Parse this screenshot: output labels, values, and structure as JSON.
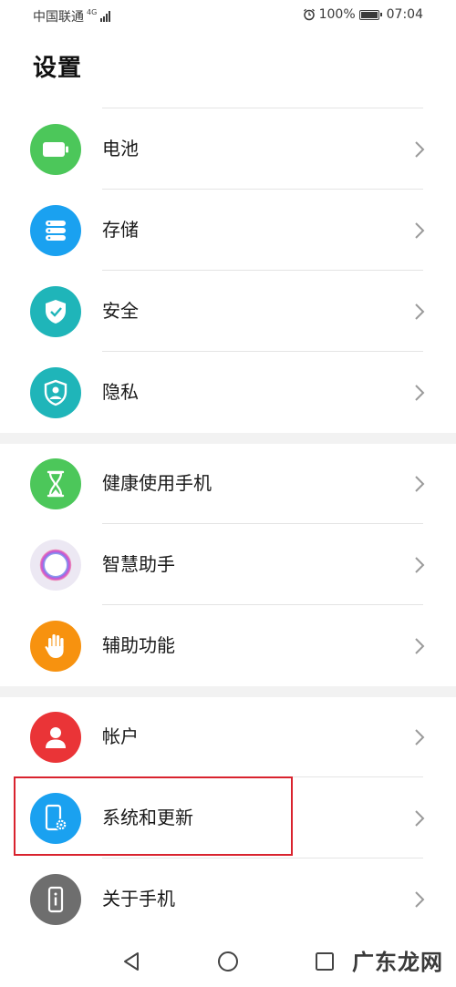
{
  "status_bar": {
    "carrier": "中国联通",
    "network": "4G",
    "battery_percent": "100%",
    "time": "07:04"
  },
  "page": {
    "title": "设置"
  },
  "sections": [
    {
      "items": [
        {
          "label": "电池",
          "icon": "battery-icon",
          "color": "#4cc75a"
        },
        {
          "label": "存储",
          "icon": "storage-icon",
          "color": "#1aa1f0"
        },
        {
          "label": "安全",
          "icon": "shield-check-icon",
          "color": "#1fb5b9"
        },
        {
          "label": "隐私",
          "icon": "privacy-icon",
          "color": "#1fb5b9"
        }
      ]
    },
    {
      "items": [
        {
          "label": "健康使用手机",
          "icon": "hourglass-icon",
          "color": "#4cc75a"
        },
        {
          "label": "智慧助手",
          "icon": "assistant-ring-icon",
          "color": "#ece8f3"
        },
        {
          "label": "辅助功能",
          "icon": "hand-icon",
          "color": "#f7920f"
        }
      ]
    },
    {
      "items": [
        {
          "label": "帐户",
          "icon": "account-icon",
          "color": "#ea3437"
        },
        {
          "label": "系统和更新",
          "icon": "system-update-icon",
          "color": "#1aa1f0"
        },
        {
          "label": "关于手机",
          "icon": "phone-info-icon",
          "color": "#6e6e6e"
        }
      ]
    }
  ],
  "watermark": "广东龙网",
  "highlight_color": "#d9232e"
}
